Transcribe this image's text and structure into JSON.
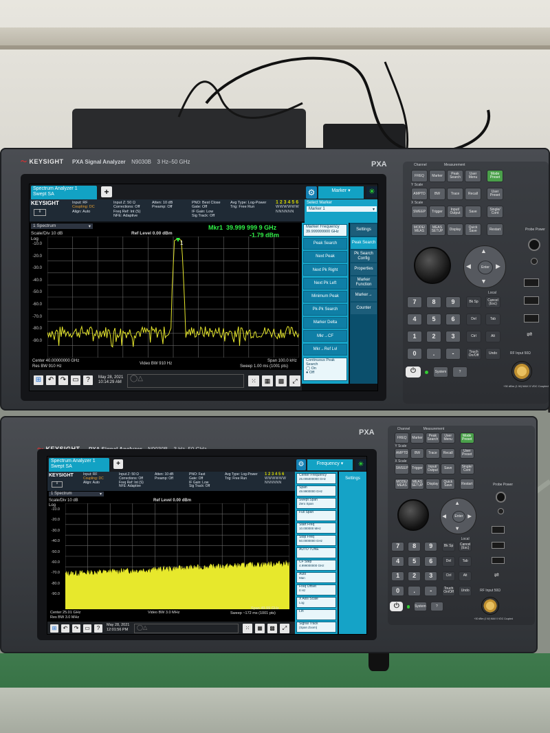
{
  "brand": "KEYSIGHT",
  "model_name": "PXA Signal Analyzer",
  "model_number": "N9030B",
  "freq_range": "3 Hz–50 GHz",
  "badge": "PXA",
  "analyzer1": {
    "tab_line1": "Spectrum Analyzer 1",
    "tab_line2": "Swept SA",
    "menu_title": "Marker",
    "info": {
      "col1": [
        "Input: RF",
        "Coupling: DC",
        "Align: Auto"
      ],
      "col2": [
        "Input Z: 50 Ω",
        "Corrections: Off",
        "Freq Ref: Int (S)",
        "NFE: Adaptive"
      ],
      "col3": [
        "Atten: 10 dB",
        "Preamp: Off"
      ],
      "col4": [
        "PNO: Best Close",
        "Gate: Off",
        "IF Gain: Low",
        "Sig Track: Off"
      ],
      "col5": [
        "Avg Type: Log-Power",
        "Trig: Free Run"
      ],
      "trace_nums": "1 2 3 4 5 6",
      "trace_code1": "WWWWWW",
      "trace_code2": "NNNNNN"
    },
    "window_label": "1 Spectrum",
    "scale": "Scale/Div 10 dB",
    "log": "Log",
    "ref_level": "Ref Level 0.00 dBm",
    "marker_label": "Mkr1",
    "marker_freq": "39.999 999 9 GHz",
    "marker_amp": "-1.79 dBm",
    "y_ticks": [
      "-10.0",
      "-20.0",
      "-30.0",
      "-40.0",
      "-50.0",
      "-60.0",
      "-70.0",
      "-80.0",
      "-90.0"
    ],
    "center": "Center 40.00000000 GHz",
    "res_bw": "Res BW 910 Hz",
    "video_bw": "Video BW 910 Hz",
    "span": "Span 100.0 kHz",
    "sweep": "Sweep 1.00 ms (1001 pts)",
    "select_marker_label": "Select Marker",
    "select_marker_value": "Marker 1",
    "marker_freq_label": "Marker Frequency",
    "marker_freq_value": "39.999999900 GHz",
    "soft_buttons": [
      "Peak Search",
      "Next Peak",
      "Next Pk Right",
      "Next Pk Left",
      "Minimum Peak",
      "Pk-Pk Search",
      "Marker Delta",
      "Mkr→CF",
      "Mkr→Ref Lvl"
    ],
    "continuous_label": "Continuous Peak Search",
    "on": "On",
    "off": "Off",
    "side_tabs": [
      "Settings",
      "Peak Search",
      "Pk Search Config",
      "Properties",
      "Marker Function",
      "Marker→",
      "Counter"
    ],
    "date": "May 28, 2021",
    "time": "10:14:29 AM"
  },
  "analyzer2": {
    "tab_line1": "Spectrum Analyzer 1",
    "tab_line2": "Swept SA",
    "menu_title": "Frequency",
    "info": {
      "col1": [
        "Input: RF",
        "Coupling: DC",
        "Align: Auto"
      ],
      "col2": [
        "Input Z: 50 Ω",
        "Corrections: Off",
        "Freq Ref: Int (S)",
        "NFE: Adaptive"
      ],
      "col3": [
        "Atten: 10 dB",
        "Preamp: Off"
      ],
      "col4": [
        "PNO: Fast",
        "Gate: Off",
        "IF Gain: Low",
        "Sig Track: Off"
      ],
      "col5": [
        "Avg Type: Log-Power",
        "Trig: Free Run"
      ],
      "trace_nums": "1 2 3 4 5 6",
      "trace_code1": "WWWWWW",
      "trace_code2": "NNNNNN"
    },
    "window_label": "1 Spectrum",
    "scale": "Scale/Div 10 dB",
    "log": "Log",
    "ref_level": "Ref Level 0.00 dBm",
    "y_ticks": [
      "-10.0",
      "-20.0",
      "-30.0",
      "-40.0",
      "-50.0",
      "-60.0",
      "-70.0",
      "-80.0",
      "-90.0"
    ],
    "center": "Center 25.01 GHz",
    "res_bw": "Res BW 3.0 MHz",
    "video_bw": "Video BW 3.0 MHz",
    "span": "Span 49.99 GHz",
    "sweep": "Sweep ~172 ms (1001 pts)",
    "soft_items": [
      {
        "label": "Center Frequency",
        "value": "25.005000000 GHz"
      },
      {
        "label": "Span",
        "value": "49.9900000 GHz"
      },
      {
        "label": "Swept Span",
        "value": "Zero Span"
      },
      {
        "label": "Full Span",
        "value": ""
      },
      {
        "label": "Start Freq",
        "value": "10.000000 MHz"
      },
      {
        "label": "Stop Freq",
        "value": "50.0000000 GHz"
      },
      {
        "label": "AUTO TUNE",
        "value": ""
      },
      {
        "label": "CF Step",
        "value": "4.999000000 GHz"
      },
      {
        "label": "Auto",
        "value": "Man"
      },
      {
        "label": "Freq Offset",
        "value": "0 Hz"
      },
      {
        "label": "X Axis Scale",
        "value": "Log"
      },
      {
        "label": "Lin",
        "value": ""
      },
      {
        "label": "Signal Track",
        "value": "(Span Zoom)"
      }
    ],
    "side_tabs": [
      "Settings"
    ],
    "date": "May 28, 2021",
    "time": "12:01:56 PM"
  },
  "keypad": {
    "section_channel": "Channel",
    "section_measurement": "Measurement",
    "row1": [
      "FREQ",
      "Marker",
      "Peak Search",
      "User Menu",
      "Mode Preset"
    ],
    "row2": [
      "AMPTD",
      "BW",
      "Trace",
      "Recall",
      "User Preset"
    ],
    "row3": [
      "SWEEP",
      "Trigger",
      "Input/ Output",
      "Save",
      "Single/ Cont"
    ],
    "row4": [
      "MODE/ MEAS",
      "MEAS SETUP",
      "Display",
      "Quick Save",
      "Restart"
    ],
    "section_y": "Y Scale",
    "section_x": "X Scale",
    "enter": "Enter",
    "local": "Local",
    "bk_sp": "Bk Sp",
    "cancel": "Cancel (Esc)",
    "del": "Del",
    "tab": "Tab",
    "ctrl": "Ctrl",
    "alt": "Alt",
    "touch": "Touch On/Off",
    "system": "System",
    "help": "?",
    "undo": "Undo",
    "numbers": [
      "7",
      "8",
      "9",
      "4",
      "5",
      "6",
      "1",
      "2",
      "3",
      "0",
      ".",
      "-"
    ],
    "probe_power": "Probe Power",
    "rf_input": "RF Input 50Ω",
    "rf_warning": "+30 dBm (1 W) MAX 0 VDC Coupled"
  },
  "colors": {
    "trace_yellow": "#e7e82c",
    "marker_green": "#2ff047",
    "menu_cyan": "#12a2c4",
    "brand_red": "#e03030"
  }
}
